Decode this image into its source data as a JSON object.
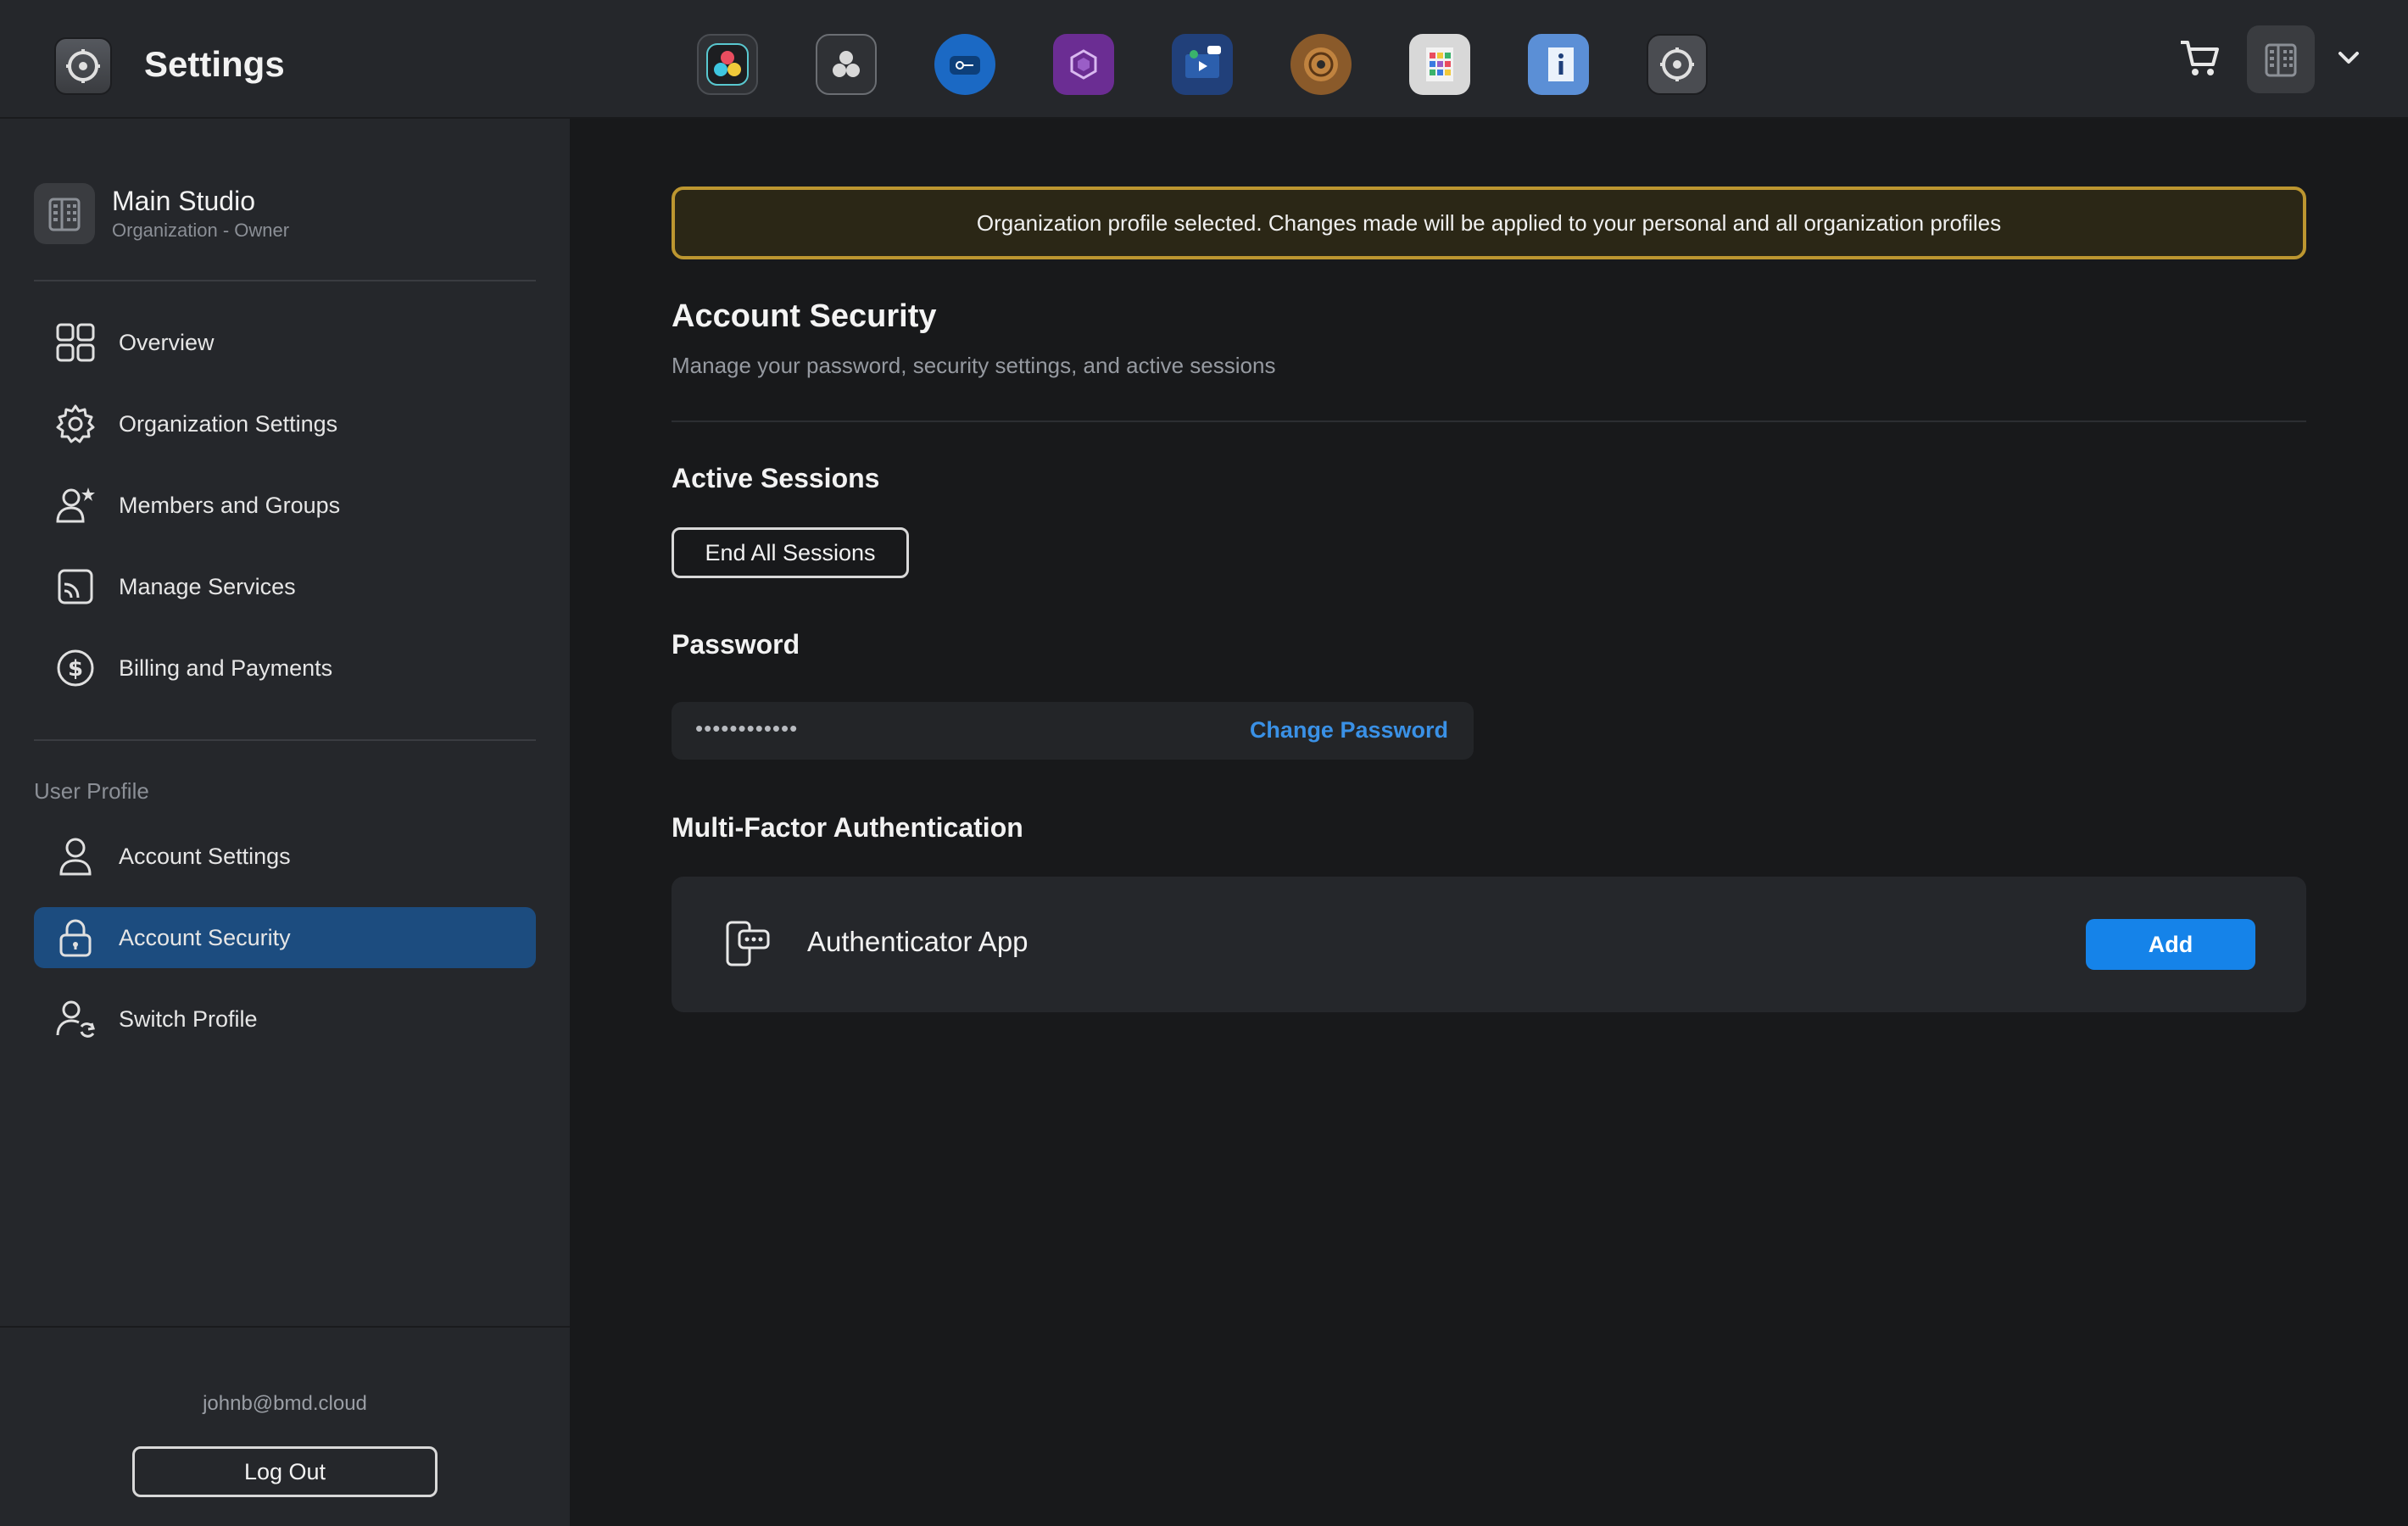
{
  "app": {
    "title": "Settings"
  },
  "dock": {
    "items": [
      {
        "icon": "resolve-icon"
      },
      {
        "icon": "fusion-icon"
      },
      {
        "icon": "key-icon"
      },
      {
        "icon": "cube-icon"
      },
      {
        "icon": "presentation-icon"
      },
      {
        "icon": "speaker-icon"
      },
      {
        "icon": "grid-document-icon"
      },
      {
        "icon": "info-document-icon"
      },
      {
        "icon": "settings-gear-icon"
      }
    ]
  },
  "header": {
    "cart_icon": "cart-icon",
    "profile_icon": "building-icon",
    "menu_icon": "chevron-down-icon"
  },
  "sidebar": {
    "org": {
      "name": "Main Studio",
      "role": "Organization - Owner"
    },
    "org_items": [
      {
        "label": "Overview",
        "icon": "grid-icon"
      },
      {
        "label": "Organization Settings",
        "icon": "gear-icon"
      },
      {
        "label": "Members and Groups",
        "icon": "user-star-icon"
      },
      {
        "label": "Manage Services",
        "icon": "cast-icon"
      },
      {
        "label": "Billing and Payments",
        "icon": "dollar-icon"
      }
    ],
    "user_section_label": "User Profile",
    "user_items": [
      {
        "label": "Account Settings",
        "icon": "user-icon"
      },
      {
        "label": "Account Security",
        "icon": "lock-icon",
        "active": true
      },
      {
        "label": "Switch Profile",
        "icon": "switch-user-icon"
      }
    ],
    "email": "johnb@bmd.cloud",
    "logout_label": "Log Out"
  },
  "main": {
    "banner": "Organization profile selected. Changes made will be applied to your personal and all organization profiles",
    "title": "Account Security",
    "subtitle": "Manage your password, security settings, and active sessions",
    "sessions": {
      "heading": "Active Sessions",
      "button": "End All Sessions"
    },
    "password": {
      "heading": "Password",
      "masked": "••••••••••••",
      "change_label": "Change Password"
    },
    "mfa": {
      "heading": "Multi-Factor Authentication",
      "method": "Authenticator App",
      "add_label": "Add"
    }
  },
  "colors": {
    "accent": "#1583e9",
    "active_nav": "#1c4c7f",
    "banner_border": "#bc9630",
    "link": "#3a91e6"
  }
}
